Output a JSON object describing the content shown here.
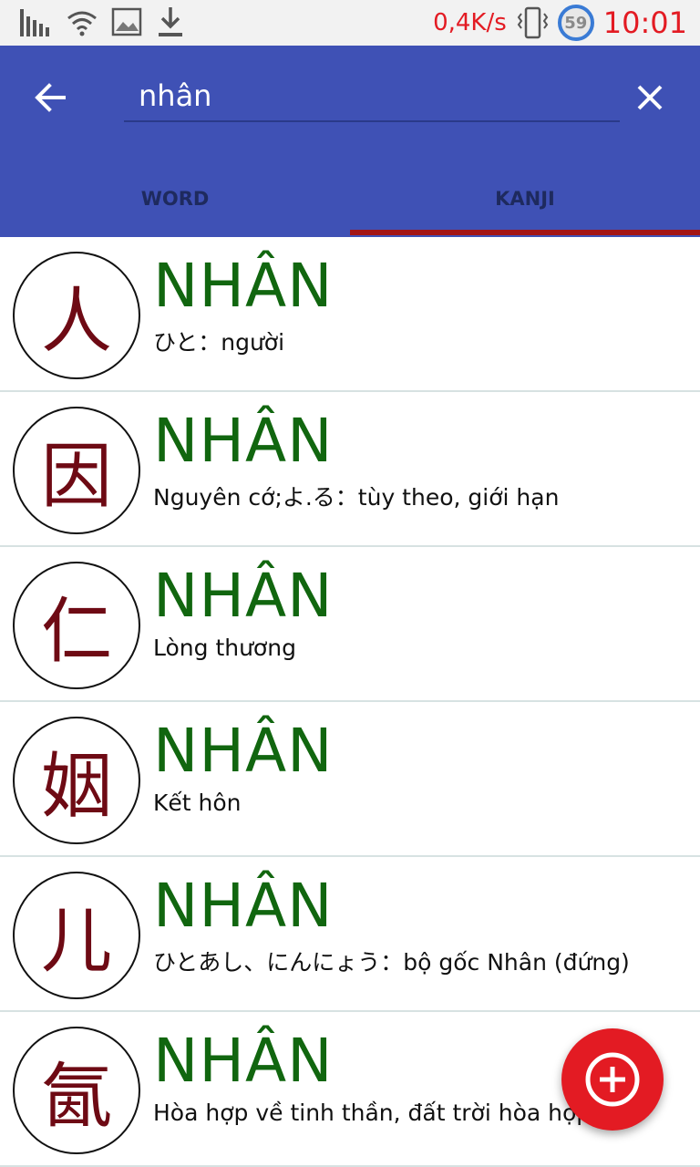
{
  "status_bar": {
    "net_speed": "0,4K/s",
    "battery_badge": "59",
    "time": "10:01",
    "icons": [
      "signal-bars-icon",
      "wifi-icon",
      "image-icon",
      "download-icon",
      "vibrate-icon"
    ]
  },
  "search": {
    "value": "nhân"
  },
  "tabs": [
    {
      "label": "WORD",
      "active": false
    },
    {
      "label": "KANJI",
      "active": true
    }
  ],
  "colors": {
    "app_bar": "#3f51b5",
    "active_tab_indicator": "#a31515",
    "reading_green": "#11660f",
    "kanji_maroon": "#6e0a14",
    "fab_red": "#e31b23"
  },
  "results": [
    {
      "kanji": "人",
      "reading": "NHÂN",
      "meaning": "ひと：người"
    },
    {
      "kanji": "因",
      "reading": "NHÂN",
      "meaning": "Nguyên cớ;よ.る：tùy theo, giới hạn"
    },
    {
      "kanji": "仁",
      "reading": "NHÂN",
      "meaning": "Lòng thương"
    },
    {
      "kanji": "姻",
      "reading": "NHÂN",
      "meaning": "Kết hôn"
    },
    {
      "kanji": "儿",
      "reading": "NHÂN",
      "meaning": "ひとあし、にんにょう：bộ gốc Nhân (đứng)"
    },
    {
      "kanji": "氤",
      "reading": "NHÂN",
      "meaning": "Hòa hợp về tinh thần, đất trời hòa hợp"
    }
  ],
  "fab": {
    "icon": "add-circle-icon"
  }
}
